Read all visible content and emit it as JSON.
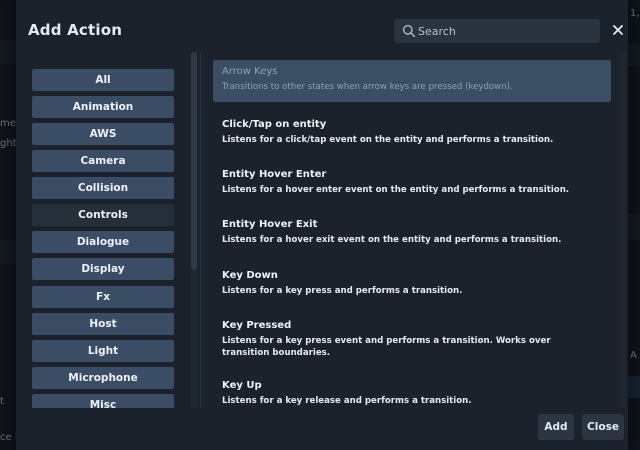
{
  "background": {
    "fragments": [
      "me",
      "ghts",
      "t",
      "ce P",
      "1,",
      "A"
    ]
  },
  "dialog": {
    "title": "Add Action",
    "close_glyph": "✕",
    "search": {
      "placeholder": "Search",
      "value": ""
    }
  },
  "categories": [
    {
      "label": "All",
      "active": false
    },
    {
      "label": "Animation",
      "active": false
    },
    {
      "label": "AWS",
      "active": false
    },
    {
      "label": "Camera",
      "active": false
    },
    {
      "label": "Collision",
      "active": false
    },
    {
      "label": "Controls",
      "active": true
    },
    {
      "label": "Dialogue",
      "active": false
    },
    {
      "label": "Display",
      "active": false
    },
    {
      "label": "Fx",
      "active": false
    },
    {
      "label": "Host",
      "active": false
    },
    {
      "label": "Light",
      "active": false
    },
    {
      "label": "Microphone",
      "active": false
    },
    {
      "label": "Misc",
      "active": false
    }
  ],
  "actions": [
    {
      "title": "Arrow Keys",
      "description": "Transitions to other states when arrow keys are pressed (keydown).",
      "selected": true
    },
    {
      "title": "Click/Tap on entity",
      "description": "Listens for a click/tap event on the entity and performs a transition.",
      "selected": false
    },
    {
      "title": "Entity Hover Enter",
      "description": "Listens for a hover enter event on the entity and performs a transition.",
      "selected": false
    },
    {
      "title": "Entity Hover Exit",
      "description": "Listens for a hover exit event on the entity and performs a transition.",
      "selected": false
    },
    {
      "title": "Key Down",
      "description": "Listens for a key press and performs a transition.",
      "selected": false
    },
    {
      "title": "Key Pressed",
      "description": "Listens for a key press event and performs a transition. Works over transition boundaries.",
      "selected": false
    },
    {
      "title": "Key Up",
      "description": "Listens for a key release and performs a transition.",
      "selected": false
    }
  ],
  "footer": {
    "add_label": "Add",
    "close_label": "Close"
  },
  "icons": {
    "search": "search-icon",
    "close": "close-icon"
  },
  "colors": {
    "dialog_bg": "#1b222b",
    "category_button": "#3a4d64",
    "category_active": "#252e39",
    "selected_action": "#3b4e63",
    "footer_button": "#2c3642"
  }
}
